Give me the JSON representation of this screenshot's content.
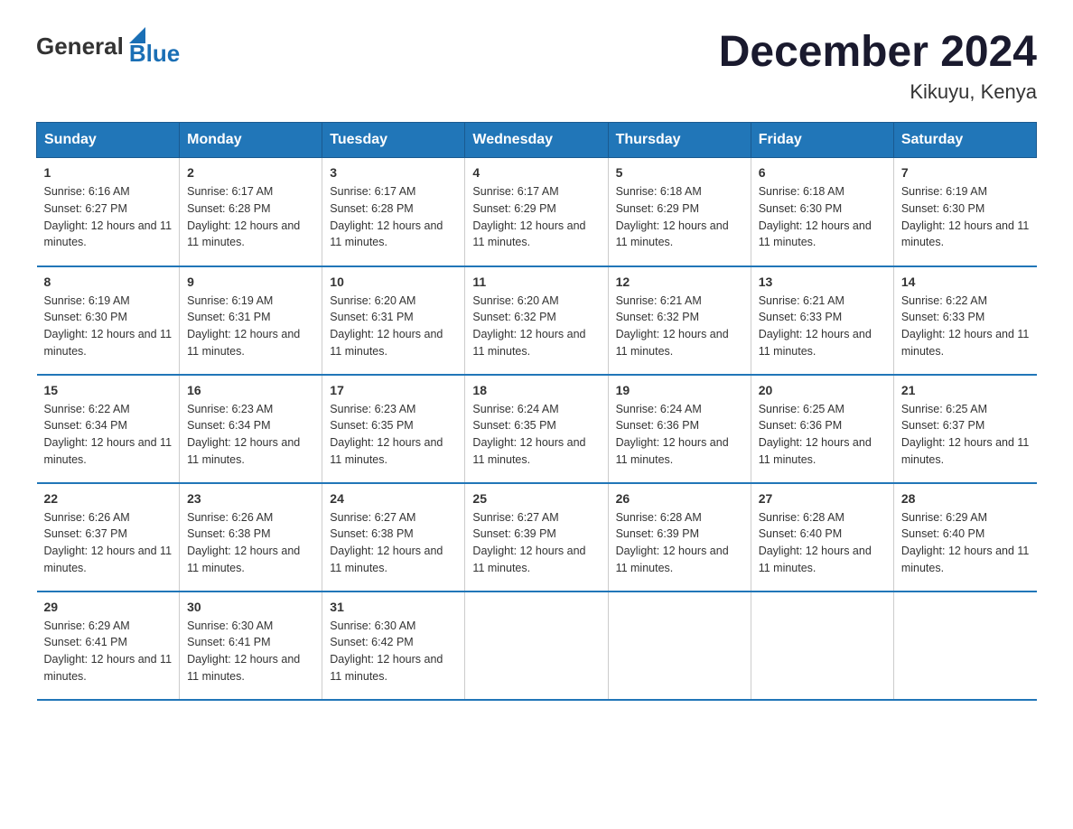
{
  "logo": {
    "general": "General",
    "blue": "Blue"
  },
  "title": "December 2024",
  "subtitle": "Kikuyu, Kenya",
  "weekdays": [
    "Sunday",
    "Monday",
    "Tuesday",
    "Wednesday",
    "Thursday",
    "Friday",
    "Saturday"
  ],
  "weeks": [
    [
      {
        "day": "1",
        "sunrise": "6:16 AM",
        "sunset": "6:27 PM",
        "daylight": "12 hours and 11 minutes."
      },
      {
        "day": "2",
        "sunrise": "6:17 AM",
        "sunset": "6:28 PM",
        "daylight": "12 hours and 11 minutes."
      },
      {
        "day": "3",
        "sunrise": "6:17 AM",
        "sunset": "6:28 PM",
        "daylight": "12 hours and 11 minutes."
      },
      {
        "day": "4",
        "sunrise": "6:17 AM",
        "sunset": "6:29 PM",
        "daylight": "12 hours and 11 minutes."
      },
      {
        "day": "5",
        "sunrise": "6:18 AM",
        "sunset": "6:29 PM",
        "daylight": "12 hours and 11 minutes."
      },
      {
        "day": "6",
        "sunrise": "6:18 AM",
        "sunset": "6:30 PM",
        "daylight": "12 hours and 11 minutes."
      },
      {
        "day": "7",
        "sunrise": "6:19 AM",
        "sunset": "6:30 PM",
        "daylight": "12 hours and 11 minutes."
      }
    ],
    [
      {
        "day": "8",
        "sunrise": "6:19 AM",
        "sunset": "6:30 PM",
        "daylight": "12 hours and 11 minutes."
      },
      {
        "day": "9",
        "sunrise": "6:19 AM",
        "sunset": "6:31 PM",
        "daylight": "12 hours and 11 minutes."
      },
      {
        "day": "10",
        "sunrise": "6:20 AM",
        "sunset": "6:31 PM",
        "daylight": "12 hours and 11 minutes."
      },
      {
        "day": "11",
        "sunrise": "6:20 AM",
        "sunset": "6:32 PM",
        "daylight": "12 hours and 11 minutes."
      },
      {
        "day": "12",
        "sunrise": "6:21 AM",
        "sunset": "6:32 PM",
        "daylight": "12 hours and 11 minutes."
      },
      {
        "day": "13",
        "sunrise": "6:21 AM",
        "sunset": "6:33 PM",
        "daylight": "12 hours and 11 minutes."
      },
      {
        "day": "14",
        "sunrise": "6:22 AM",
        "sunset": "6:33 PM",
        "daylight": "12 hours and 11 minutes."
      }
    ],
    [
      {
        "day": "15",
        "sunrise": "6:22 AM",
        "sunset": "6:34 PM",
        "daylight": "12 hours and 11 minutes."
      },
      {
        "day": "16",
        "sunrise": "6:23 AM",
        "sunset": "6:34 PM",
        "daylight": "12 hours and 11 minutes."
      },
      {
        "day": "17",
        "sunrise": "6:23 AM",
        "sunset": "6:35 PM",
        "daylight": "12 hours and 11 minutes."
      },
      {
        "day": "18",
        "sunrise": "6:24 AM",
        "sunset": "6:35 PM",
        "daylight": "12 hours and 11 minutes."
      },
      {
        "day": "19",
        "sunrise": "6:24 AM",
        "sunset": "6:36 PM",
        "daylight": "12 hours and 11 minutes."
      },
      {
        "day": "20",
        "sunrise": "6:25 AM",
        "sunset": "6:36 PM",
        "daylight": "12 hours and 11 minutes."
      },
      {
        "day": "21",
        "sunrise": "6:25 AM",
        "sunset": "6:37 PM",
        "daylight": "12 hours and 11 minutes."
      }
    ],
    [
      {
        "day": "22",
        "sunrise": "6:26 AM",
        "sunset": "6:37 PM",
        "daylight": "12 hours and 11 minutes."
      },
      {
        "day": "23",
        "sunrise": "6:26 AM",
        "sunset": "6:38 PM",
        "daylight": "12 hours and 11 minutes."
      },
      {
        "day": "24",
        "sunrise": "6:27 AM",
        "sunset": "6:38 PM",
        "daylight": "12 hours and 11 minutes."
      },
      {
        "day": "25",
        "sunrise": "6:27 AM",
        "sunset": "6:39 PM",
        "daylight": "12 hours and 11 minutes."
      },
      {
        "day": "26",
        "sunrise": "6:28 AM",
        "sunset": "6:39 PM",
        "daylight": "12 hours and 11 minutes."
      },
      {
        "day": "27",
        "sunrise": "6:28 AM",
        "sunset": "6:40 PM",
        "daylight": "12 hours and 11 minutes."
      },
      {
        "day": "28",
        "sunrise": "6:29 AM",
        "sunset": "6:40 PM",
        "daylight": "12 hours and 11 minutes."
      }
    ],
    [
      {
        "day": "29",
        "sunrise": "6:29 AM",
        "sunset": "6:41 PM",
        "daylight": "12 hours and 11 minutes."
      },
      {
        "day": "30",
        "sunrise": "6:30 AM",
        "sunset": "6:41 PM",
        "daylight": "12 hours and 11 minutes."
      },
      {
        "day": "31",
        "sunrise": "6:30 AM",
        "sunset": "6:42 PM",
        "daylight": "12 hours and 11 minutes."
      },
      null,
      null,
      null,
      null
    ]
  ]
}
